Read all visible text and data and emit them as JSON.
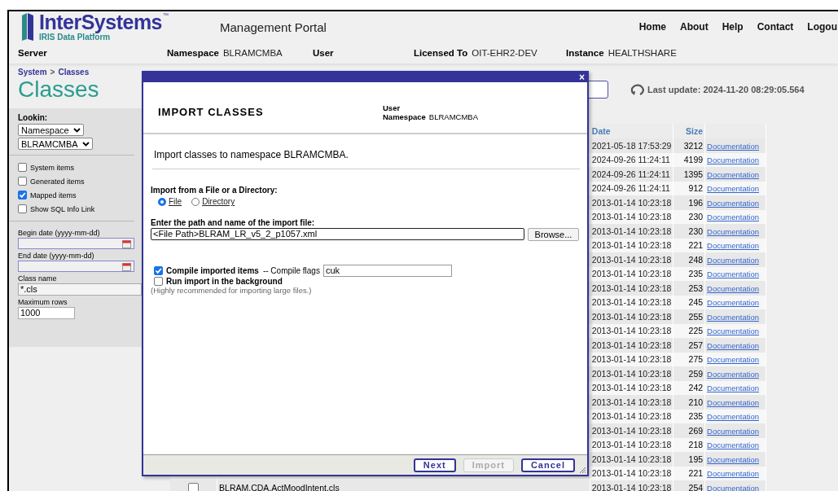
{
  "header": {
    "logo": {
      "brand": "InterSystems",
      "trademark": "™",
      "product": "IRIS Data Platform"
    },
    "title": "Management Portal",
    "nav": [
      "Home",
      "About",
      "Help",
      "Contact",
      "Logou"
    ],
    "info": [
      {
        "label": "Server"
      },
      {
        "label": "Namespace",
        "value": "BLRAMCMBA"
      },
      {
        "label": "User"
      },
      {
        "label": "Licensed To",
        "value": "OIT-EHR2-DEV"
      },
      {
        "label": "Instance",
        "value": "HEALTHSHARE"
      }
    ]
  },
  "breadcrumb": {
    "items": [
      "System",
      "Classes"
    ],
    "separator": ">"
  },
  "page_title": "Classes",
  "last_update": "Last update: 2024-11-20 08:29:05.564",
  "sidebar": {
    "lookin_label": "Lookin:",
    "selects": [
      "Namespace",
      "BLRAMCMBA"
    ],
    "checkboxes": [
      {
        "label": "System items",
        "checked": false
      },
      {
        "label": "Generated items",
        "checked": false
      },
      {
        "label": "Mapped items",
        "checked": true
      },
      {
        "label": "Show SQL Info Link",
        "checked": false
      }
    ],
    "fields": [
      {
        "label": "Begin date (yyyy-mm-dd)",
        "kind": "date"
      },
      {
        "label": "End date (yyyy-mm-dd)",
        "kind": "date"
      },
      {
        "label": "Class name",
        "kind": "text",
        "value": "*.cls"
      },
      {
        "label": "Maximum rows",
        "kind": "short",
        "value": "1000"
      }
    ]
  },
  "table": {
    "columns": [
      "Date",
      "Size"
    ],
    "rows": [
      {
        "date": "2021-05-18 17:53:29",
        "size": "3212",
        "link": "Documentation"
      },
      {
        "date": "2024-09-26 11:24:11",
        "size": "4199",
        "link": "Documentation"
      },
      {
        "date": "2024-09-26 11:24:11",
        "size": "1395",
        "link": "Documentation"
      },
      {
        "date": "2024-09-26 11:24:11",
        "size": "912",
        "link": "Documentation"
      },
      {
        "date": "2013-01-14 10:23:18",
        "size": "196",
        "link": "Documentation"
      },
      {
        "date": "2013-01-14 10:23:18",
        "size": "230",
        "link": "Documentation"
      },
      {
        "date": "2013-01-14 10:23:18",
        "size": "230",
        "link": "Documentation"
      },
      {
        "date": "2013-01-14 10:23:18",
        "size": "221",
        "link": "Documentation"
      },
      {
        "date": "2013-01-14 10:23:18",
        "size": "248",
        "link": "Documentation"
      },
      {
        "date": "2013-01-14 10:23:18",
        "size": "235",
        "link": "Documentation"
      },
      {
        "date": "2013-01-14 10:23:18",
        "size": "253",
        "link": "Documentation"
      },
      {
        "date": "2013-01-14 10:23:18",
        "size": "245",
        "link": "Documentation"
      },
      {
        "date": "2013-01-14 10:23:18",
        "size": "255",
        "link": "Documentation"
      },
      {
        "date": "2013-01-14 10:23:18",
        "size": "225",
        "link": "Documentation"
      },
      {
        "date": "2013-01-14 10:23:18",
        "size": "257",
        "link": "Documentation"
      },
      {
        "date": "2013-01-14 10:23:18",
        "size": "275",
        "link": "Documentation"
      },
      {
        "date": "2013-01-14 10:23:18",
        "size": "259",
        "link": "Documentation"
      },
      {
        "date": "2013-01-14 10:23:18",
        "size": "242",
        "link": "Documentation"
      },
      {
        "date": "2013-01-14 10:23:18",
        "size": "210",
        "link": "Documentation"
      },
      {
        "date": "2013-01-14 10:23:18",
        "size": "235",
        "link": "Documentation"
      },
      {
        "date": "2013-01-14 10:23:18",
        "size": "269",
        "link": "Documentation"
      },
      {
        "date": "2013-01-14 10:23:18",
        "size": "218",
        "link": "Documentation"
      },
      {
        "date": "2013-01-14 10:23:18",
        "size": "195",
        "link": "Documentation"
      },
      {
        "date": "2013-01-14 10:23:18",
        "size": "221",
        "link": "Documentation"
      },
      {
        "checked": false,
        "name": "BLRAM.CDA.ActMoodIntent.cls",
        "date": "2013-01-14 10:23:18",
        "size": "254",
        "link": "Documentation"
      }
    ]
  },
  "dialog": {
    "close": "×",
    "heading": "IMPORT CLASSES",
    "user_label": "User",
    "namespace_label": "Namespace",
    "namespace": "BLRAMCMBA",
    "intro": "Import classes to namespace BLRAMCMBA.",
    "source_label": "Import from a File or a Directory:",
    "source_options": [
      {
        "label": "File",
        "selected": true
      },
      {
        "label": "Directory",
        "selected": false
      }
    ],
    "path_label": "Enter the path and name of the import file:",
    "path_value": "<File Path>BLRAM_LR_v5_2_p1057.xml",
    "browse": "Browse...",
    "compile": {
      "label": "Compile imported items",
      "checked": true,
      "flags_label": "-- Compile flags",
      "flags": "cuk"
    },
    "background": {
      "label": "Run import in the background",
      "checked": false
    },
    "hint": "(Highly recommended for importing large files.)",
    "buttons": [
      {
        "label": "Next",
        "disabled": false
      },
      {
        "label": "Import",
        "disabled": true
      },
      {
        "label": "Cancel",
        "disabled": false
      }
    ]
  }
}
